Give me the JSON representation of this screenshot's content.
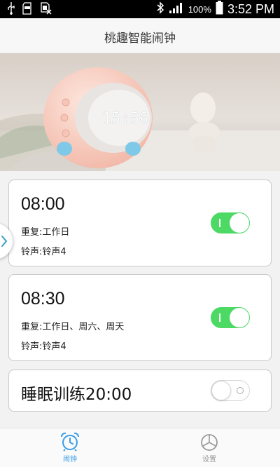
{
  "status_bar": {
    "battery_percent": "100%",
    "time": "3:52 PM",
    "icons": [
      "usb-icon",
      "sd-card-icon",
      "no-sim-icon",
      "bluetooth-icon",
      "signal-icon",
      "battery-icon"
    ]
  },
  "header": {
    "title": "桃趣智能闹钟"
  },
  "hero": {
    "clock_display": "15:56"
  },
  "alarms": [
    {
      "time": "08:00",
      "repeat": "重复:工作日",
      "ringtone": "铃声:铃声4",
      "enabled": true
    },
    {
      "time": "08:30",
      "repeat": "重复:工作日、周六、周天",
      "ringtone": "铃声:铃声4",
      "enabled": true
    }
  ],
  "sleep_training": {
    "label": "睡眠训练20:00",
    "enabled": false
  },
  "bottom_nav": {
    "items": [
      {
        "label": "闹钟",
        "icon": "alarm-clock-icon",
        "active": true
      },
      {
        "label": "设置",
        "icon": "settings-icon",
        "active": false
      }
    ]
  },
  "colors": {
    "toggle_on": "#4cd964",
    "nav_active": "#3a9ee8",
    "nav_inactive": "#999999"
  }
}
